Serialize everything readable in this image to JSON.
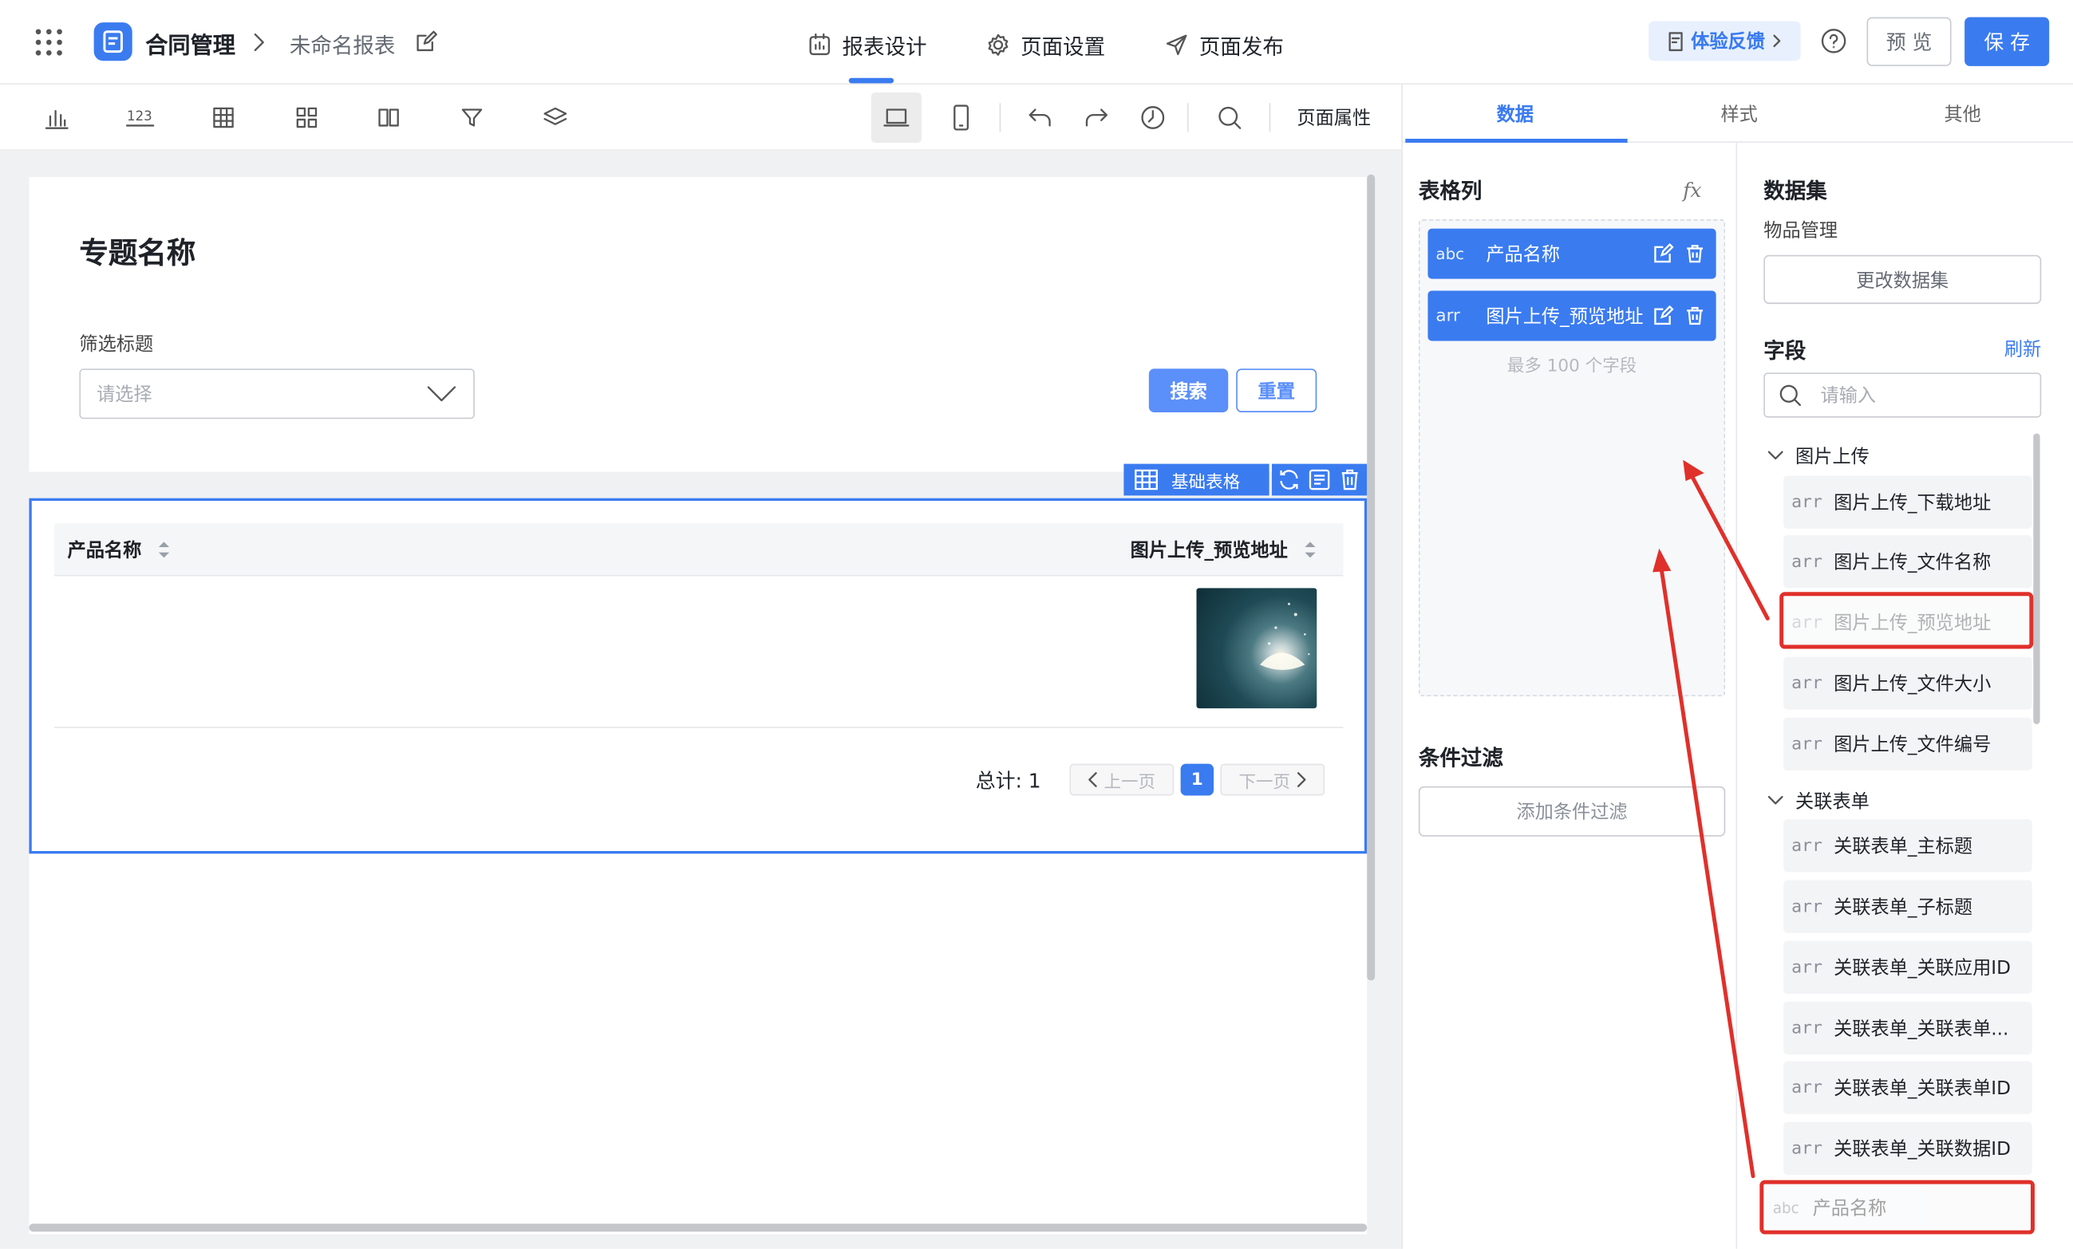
{
  "header": {
    "app_name": "合同管理",
    "report_name": "未命名报表",
    "tabs": [
      "报表设计",
      "页面设置",
      "页面发布"
    ],
    "feedback_label": "体验反馈",
    "preview_label": "预 览",
    "save_label": "保 存",
    "accent": "#3a7bf0"
  },
  "toolbar": {
    "page_props_label": "页面属性"
  },
  "canvas": {
    "topic_title": "专题名称",
    "filter_label": "筛选标题",
    "filter_placeholder": "请选择",
    "search_label": "搜索",
    "reset_label": "重置",
    "component_label": "基础表格",
    "table": {
      "headers": [
        "产品名称",
        "图片上传_预览地址"
      ],
      "total_label": "总计: 1",
      "prev_label": "上一页",
      "next_label": "下一页",
      "current_page": "1"
    }
  },
  "right_tabs": [
    "数据",
    "样式",
    "其他"
  ],
  "columns_panel": {
    "title": "表格列",
    "fx_label": "fx",
    "items": [
      {
        "type": "abc",
        "label": "产品名称"
      },
      {
        "type": "arr",
        "label": "图片上传_预览地址"
      }
    ],
    "hint": "最多 100 个字段",
    "filter_title": "条件过滤",
    "add_filter_label": "添加条件过滤"
  },
  "dataset_panel": {
    "title": "数据集",
    "dataset_name": "物品管理",
    "change_label": "更改数据集",
    "fields_title": "字段",
    "refresh_label": "刷新",
    "search_placeholder": "请输入",
    "groups": [
      {
        "name": "图片上传",
        "fields": [
          {
            "type": "arr",
            "label": "图片上传_下载地址"
          },
          {
            "type": "arr",
            "label": "图片上传_文件名称"
          },
          {
            "type": "arr",
            "label": "图片上传_预览地址"
          },
          {
            "type": "arr",
            "label": "图片上传_文件大小"
          },
          {
            "type": "arr",
            "label": "图片上传_文件编号"
          }
        ]
      },
      {
        "name": "关联表单",
        "fields": [
          {
            "type": "arr",
            "label": "关联表单_主标题"
          },
          {
            "type": "arr",
            "label": "关联表单_子标题"
          },
          {
            "type": "arr",
            "label": "关联表单_关联应用ID"
          },
          {
            "type": "arr",
            "label": "关联表单_关联表单..."
          },
          {
            "type": "arr",
            "label": "关联表单_关联表单ID"
          },
          {
            "type": "arr",
            "label": "关联表单_关联数据ID"
          }
        ]
      }
    ],
    "last_field": {
      "type": "abc",
      "label": "产品名称"
    }
  }
}
